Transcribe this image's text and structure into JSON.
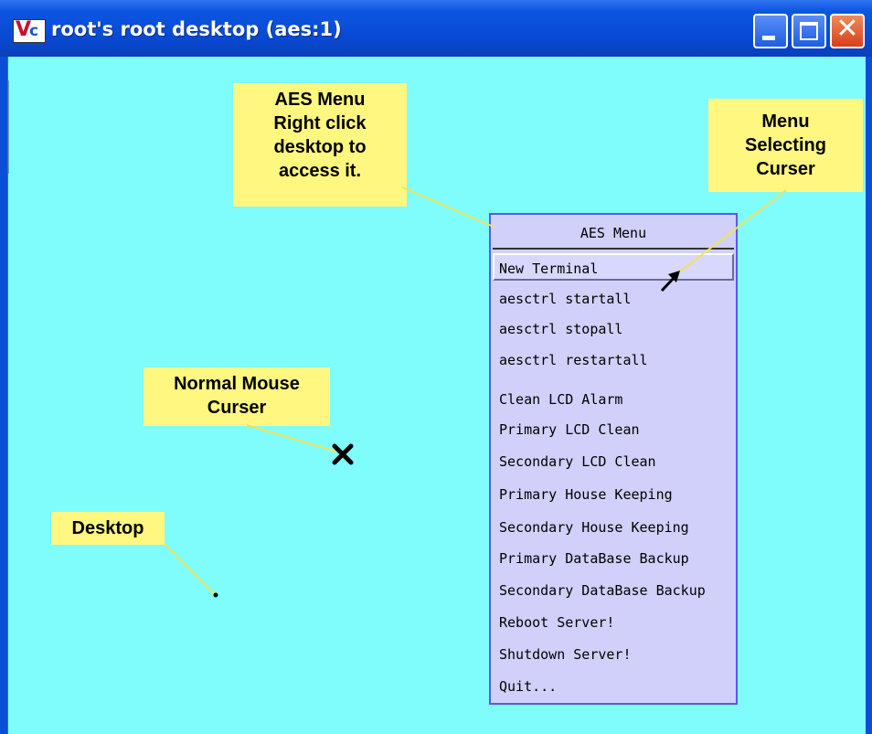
{
  "window": {
    "title": "root's root desktop (aes:1)",
    "icon": "vnc-viewer-icon",
    "accent_color": "#0a4fd6"
  },
  "desktop": {
    "background_color": "#7ffdfd"
  },
  "callouts": {
    "aes_menu": {
      "lines": [
        "AES Menu",
        "Right click",
        "desktop to",
        "access it."
      ]
    },
    "menu_selecting_cursor": {
      "lines": [
        "Menu",
        "Selecting",
        "Curser"
      ]
    },
    "normal_mouse_cursor": {
      "lines": [
        "Normal Mouse",
        "Curser"
      ]
    },
    "desktop": {
      "lines": [
        "Desktop"
      ]
    },
    "background_color": "#fff780"
  },
  "menu": {
    "title": "AES Menu",
    "items": [
      {
        "label": "New Terminal",
        "selected": true
      },
      {
        "label": "aesctrl startall"
      },
      {
        "label": "aesctrl stopall"
      },
      {
        "label": "aesctrl restartall"
      },
      {
        "label": "Clean LCD Alarm"
      },
      {
        "label": "Primary LCD Clean"
      },
      {
        "label": "Secondary LCD Clean"
      },
      {
        "label": "Primary House Keeping"
      },
      {
        "label": "Secondary House Keeping"
      },
      {
        "label": "Primary DataBase Backup"
      },
      {
        "label": "Secondary DataBase Backup"
      },
      {
        "label": "Reboot Server!"
      },
      {
        "label": "Shutdown Server!"
      },
      {
        "label": "Quit..."
      }
    ]
  }
}
